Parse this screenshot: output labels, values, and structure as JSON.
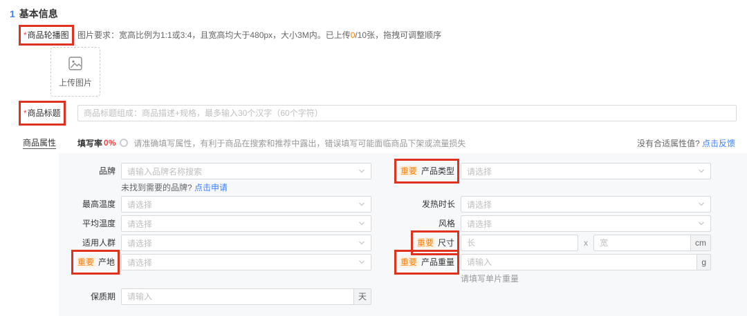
{
  "colors": {
    "accent_blue": "#3d7fff",
    "danger_red": "#f53f3f",
    "warning_orange": "#ff7d00",
    "annotation_red": "#e0301e",
    "panel_bg": "#f7f8fa"
  },
  "section": {
    "number": "1",
    "title": "基本信息"
  },
  "carousel": {
    "required_mark": "*",
    "label": "商品轮播图",
    "req_prefix": "图片要求：宽高比例为1:1或3:4，且宽高均大于480px，大小3M内。已上传",
    "req_count": "0",
    "req_suffix": "/10张，拖拽可调整顺序",
    "upload_label": "上传图片"
  },
  "title_field": {
    "required_mark": "*",
    "label": "商品标题",
    "placeholder": "商品标题组成：商品描述+规格，最多输入30个汉字（60个字符）"
  },
  "attrs_header": {
    "label": "商品属性",
    "fill_rate_label": "填写率",
    "fill_rate_value": "0%",
    "tip": "请准确填写属性，有利于商品在搜索和推荐中露出，错误填写可能面临商品下架或流量损失",
    "feedback_text": "没有合适属性值?",
    "feedback_link": "点击反馈"
  },
  "fields": {
    "brand": {
      "label": "品牌",
      "placeholder": "请输入品牌名称搜索",
      "hint_text": "未找到需要的品牌?",
      "hint_link": "点击申请"
    },
    "product_type": {
      "badge": "重要",
      "label": "产品类型",
      "placeholder": "请选择"
    },
    "max_temperature": {
      "label": "最高温度",
      "placeholder": "请选择"
    },
    "heating_duration": {
      "label": "发热时长",
      "placeholder": "请选择"
    },
    "avg_temperature": {
      "label": "平均温度",
      "placeholder": "请选择"
    },
    "style": {
      "label": "风格",
      "placeholder": "请选择"
    },
    "audience": {
      "label": "适用人群",
      "placeholder": "请选择"
    },
    "size": {
      "badge": "重要",
      "label": "尺寸",
      "length_placeholder": "长",
      "separator": "x",
      "width_placeholder": "宽",
      "unit": "cm"
    },
    "origin": {
      "badge": "重要",
      "label": "产地",
      "placeholder": "请选择"
    },
    "weight": {
      "badge": "重要",
      "label": "产品重量",
      "placeholder": "请输入",
      "unit": "g",
      "hint": "请填写单片重量"
    },
    "shelf_life": {
      "label": "保质期",
      "placeholder": "请输入",
      "unit": "天"
    }
  }
}
